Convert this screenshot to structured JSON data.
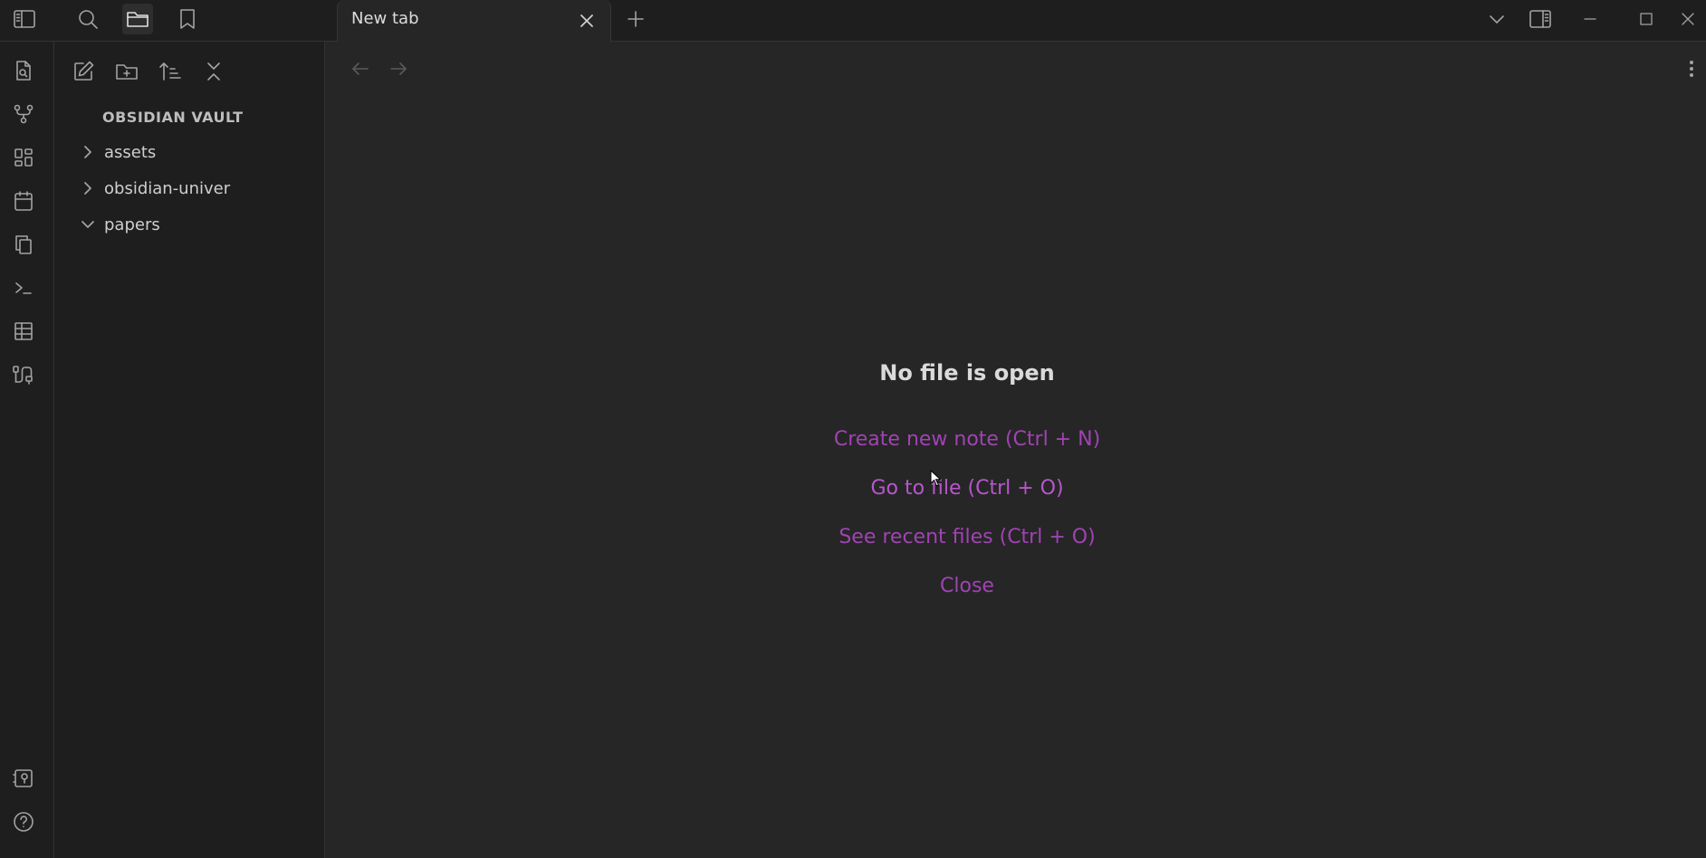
{
  "titlebar": {
    "tab_title": "New tab"
  },
  "sidebar": {
    "vault_name": "OBSIDIAN VAULT",
    "items": [
      {
        "label": "assets",
        "state": "collapsed"
      },
      {
        "label": "obsidian-univer",
        "state": "collapsed"
      },
      {
        "label": "papers",
        "state": "expanded"
      }
    ]
  },
  "empty_state": {
    "title": "No file is open",
    "actions": [
      "Create new note (Ctrl + N)",
      "Go to file (Ctrl + O)",
      "See recent files (Ctrl + O)",
      "Close"
    ]
  },
  "colors": {
    "accent": "#a043b3",
    "background": "#262626",
    "sidebar": "#1e1e1e"
  },
  "icons": {
    "titlebar": [
      "sidebar-toggle-icon",
      "search-icon",
      "folder-icon",
      "bookmark-icon",
      "plus-icon",
      "chevron-down-icon",
      "right-sidebar-icon",
      "minimize-icon",
      "maximize-icon",
      "close-icon"
    ],
    "ribbon": [
      "file-search-icon",
      "graph-icon",
      "layout-dashboard-icon",
      "calendar-icon",
      "copy-icon",
      "terminal-icon",
      "table-icon",
      "cable-icon",
      "vault-icon",
      "help-icon"
    ]
  }
}
